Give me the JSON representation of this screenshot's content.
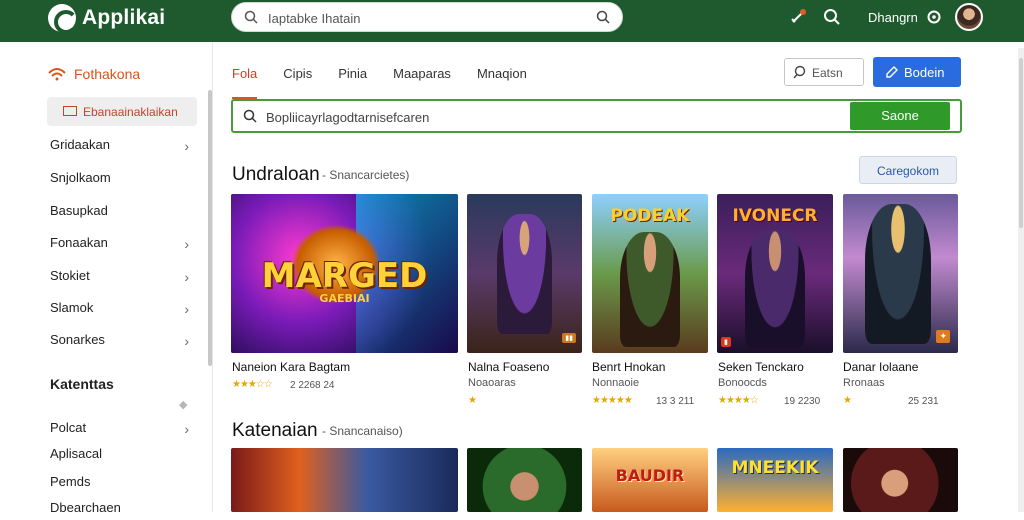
{
  "app": {
    "name": "Applikai",
    "brand_color": "#1e5a2e",
    "accent": "#d9541e"
  },
  "topbar": {
    "search_placeholder": "Iaptabke Ihatain",
    "user_name": "Dhangrn",
    "icons": [
      "rocket-icon",
      "search-icon",
      "settings-icon"
    ]
  },
  "sidebar": {
    "header": "Fothakona",
    "active_item": "Ebanaainaklaikan",
    "items": [
      {
        "label": "Gridaakan",
        "chevron": true
      },
      {
        "label": "Snjolkaom",
        "chevron": false
      },
      {
        "label": "Basupkad",
        "chevron": false
      },
      {
        "label": "Fonaakan",
        "chevron": true
      },
      {
        "label": "Stokiet",
        "chevron": true
      },
      {
        "label": "Slamok",
        "chevron": true
      },
      {
        "label": "Sonarkes",
        "chevron": true
      }
    ],
    "section": "Katenttas",
    "section_items": [
      {
        "label": "Polcat",
        "chevron": true
      },
      {
        "label": "Aplisacal",
        "chevron": false
      },
      {
        "label": "Pemds",
        "chevron": false
      },
      {
        "label": "Dbearchaen",
        "chevron": false
      }
    ]
  },
  "tabs": [
    {
      "label": "Fola",
      "active": true
    },
    {
      "label": "Cipis",
      "active": false
    },
    {
      "label": "Pinia",
      "active": false
    },
    {
      "label": "Maaparas",
      "active": false
    },
    {
      "label": "Mnaqion",
      "active": false
    }
  ],
  "toolbar": {
    "filter_label": "Eatsn",
    "primary_label": "Bodein"
  },
  "main_search": {
    "placeholder": "Bopliicayrlagodtarnisefcaren",
    "button": "Saone"
  },
  "section1": {
    "title": "Undraloan",
    "subtitle": "Snancarcietes)",
    "button": "Caregokom",
    "cards": [
      {
        "title": "Naneion Kara Bagtam",
        "sub": "",
        "rating": "★★★☆☆",
        "meta": "2 2268 24",
        "art_label": "MARGED",
        "art_sub": "GAEBIAI"
      },
      {
        "title": "Nalna Foaseno",
        "sub": "Noaoaras",
        "rating": "★",
        "meta": "",
        "art_label": "",
        "tag": ""
      },
      {
        "title": "Benrt Hnokan",
        "sub": "Nonnaoie",
        "rating": "★★★★★",
        "meta": "13 3 211",
        "art_label": "PODEAK"
      },
      {
        "title": "Seken Tenckaro",
        "sub": "Bonoocds",
        "rating": "★★★★☆",
        "meta": "19 2230",
        "art_label": "IVONECR"
      },
      {
        "title": "Danar Iolaane",
        "sub": "Rronaas",
        "rating": "★",
        "meta": "25 231",
        "art_label": ""
      }
    ]
  },
  "section2": {
    "title": "Katenaian",
    "subtitle": "Snancanaiso)",
    "cards": [
      {
        "art_label": ""
      },
      {
        "art_label": ""
      },
      {
        "art_label": "BAUDIR"
      },
      {
        "art_label": "MNEEKIK"
      },
      {
        "art_label": ""
      }
    ]
  }
}
